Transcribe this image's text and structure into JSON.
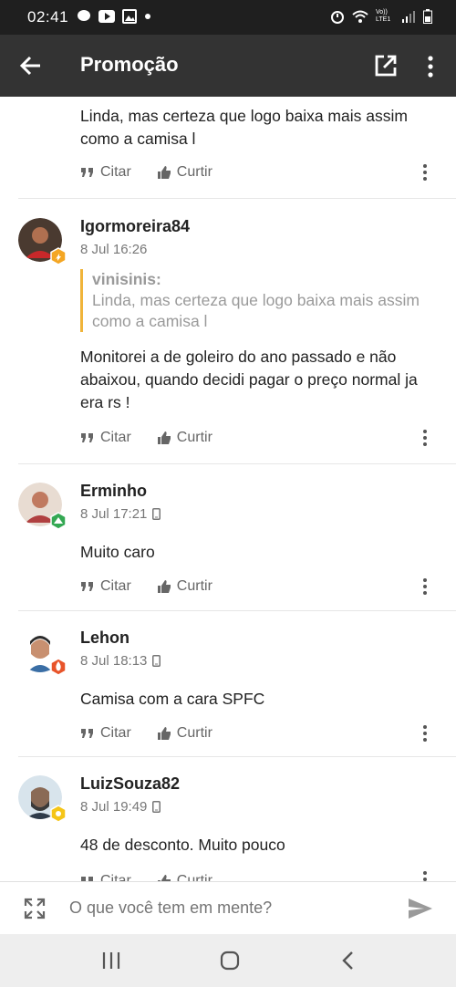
{
  "status_bar": {
    "time": "02:41",
    "left_icons": [
      "chat-bubble-icon",
      "youtube-icon",
      "image-icon",
      "dot-icon"
    ],
    "right_icons": [
      "alarm-icon",
      "wifi-icon",
      "volte-icon",
      "signal-icon",
      "battery-icon"
    ],
    "volte_label": "Vo)) LTE1"
  },
  "app_bar": {
    "title": "Promoção",
    "back_icon": "arrow-back-icon",
    "external_icon": "open-in-new-icon",
    "more_icon": "more-vert-icon"
  },
  "actions": {
    "quote_label": "Citar",
    "like_label": "Curtir"
  },
  "posts": [
    {
      "text": "Linda, mas certeza que logo baixa mais assim como a camisa l"
    },
    {
      "author": "Igormoreira84",
      "date": "8 Jul 16:26",
      "mobile": false,
      "quote": {
        "author": "vinisinis:",
        "text": "Linda, mas certeza que logo baixa mais assim como a camisa l"
      },
      "text": "Monitorei a de goleiro do ano passado e não abaixou, quando decidi pagar o preço normal ja era rs !",
      "badge_color": "#f4a623"
    },
    {
      "author": "Erminho",
      "date": "8 Jul 17:21",
      "mobile": true,
      "text": "Muito caro",
      "badge_color": "#34a853"
    },
    {
      "author": "Lehon",
      "date": "8 Jul 18:13",
      "mobile": true,
      "text": "Camisa com a cara SPFC",
      "badge_color": "#e8542a"
    },
    {
      "author": "LuizSouza82",
      "date": "8 Jul 19:49",
      "mobile": true,
      "text": "48 de desconto. Muito pouco",
      "badge_color": "#f5c518"
    }
  ],
  "composer": {
    "placeholder": "O que você tem em mente?",
    "expand_icon": "expand-icon",
    "send_icon": "send-icon"
  },
  "nav_bar": {
    "icons": [
      "recent-apps-icon",
      "home-icon",
      "back-nav-icon"
    ]
  }
}
